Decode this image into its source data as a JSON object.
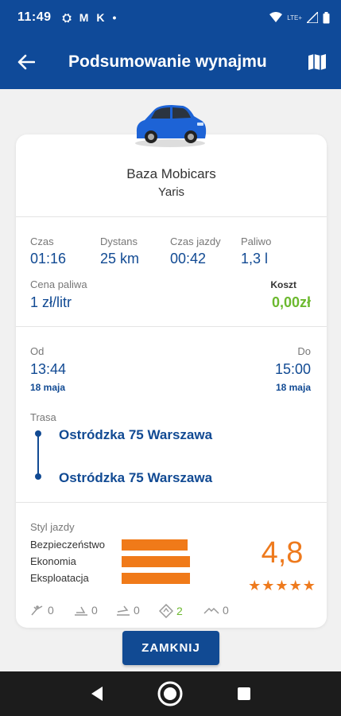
{
  "status_bar": {
    "time": "11:49",
    "notif_glyph_1": "⛭",
    "notif_glyph_2": "M",
    "notif_glyph_3": "K",
    "dot": "•",
    "network": "LTE+"
  },
  "header": {
    "title": "Podsumowanie wynajmu"
  },
  "rental": {
    "base": "Baza Mobicars",
    "model": "Yaris"
  },
  "stats": {
    "time_label": "Czas",
    "time_value": "01:16",
    "distance_label": "Dystans",
    "distance_value": "25 km",
    "drive_time_label": "Czas jazdy",
    "drive_time_value": "00:42",
    "fuel_label": "Paliwo",
    "fuel_value": "1,3 l",
    "fuel_price_label": "Cena paliwa",
    "fuel_price_value": "1 zł/litr",
    "cost_label": "Koszt",
    "cost_value": "0,00zł"
  },
  "trip": {
    "from_label": "Od",
    "from_time": "13:44",
    "from_date": "18 maja",
    "to_label": "Do",
    "to_time": "15:00",
    "to_date": "18 maja",
    "route_label": "Trasa",
    "route_start": "Ostródzka 75 Warszawa",
    "route_end": "Ostródzka 75 Warszawa"
  },
  "driving_style": {
    "label": "Styl jazdy",
    "rows": [
      {
        "name": "Bezpieczeństwo",
        "fill": 0.97
      },
      {
        "name": "Ekonomia",
        "fill": 1.0
      },
      {
        "name": "Eksploatacja",
        "fill": 1.0
      }
    ],
    "score": "4,8",
    "stars": "★★★★★",
    "stars_count": 5
  },
  "events": [
    {
      "icon": "sharp-turn-icon",
      "count": "0"
    },
    {
      "icon": "hard-braking-icon",
      "count": "0"
    },
    {
      "icon": "hard-acceleration-icon",
      "count": "0"
    },
    {
      "icon": "speeding-sign-icon",
      "count": "2"
    },
    {
      "icon": "bump-icon",
      "count": "0"
    }
  ],
  "actions": {
    "close_label": "ZAMKNIJ"
  },
  "colors": {
    "primary": "#0f4a99",
    "accent_orange": "#ee7a1d",
    "green": "#6cb92f",
    "nav_bg": "#1c1c1c"
  }
}
